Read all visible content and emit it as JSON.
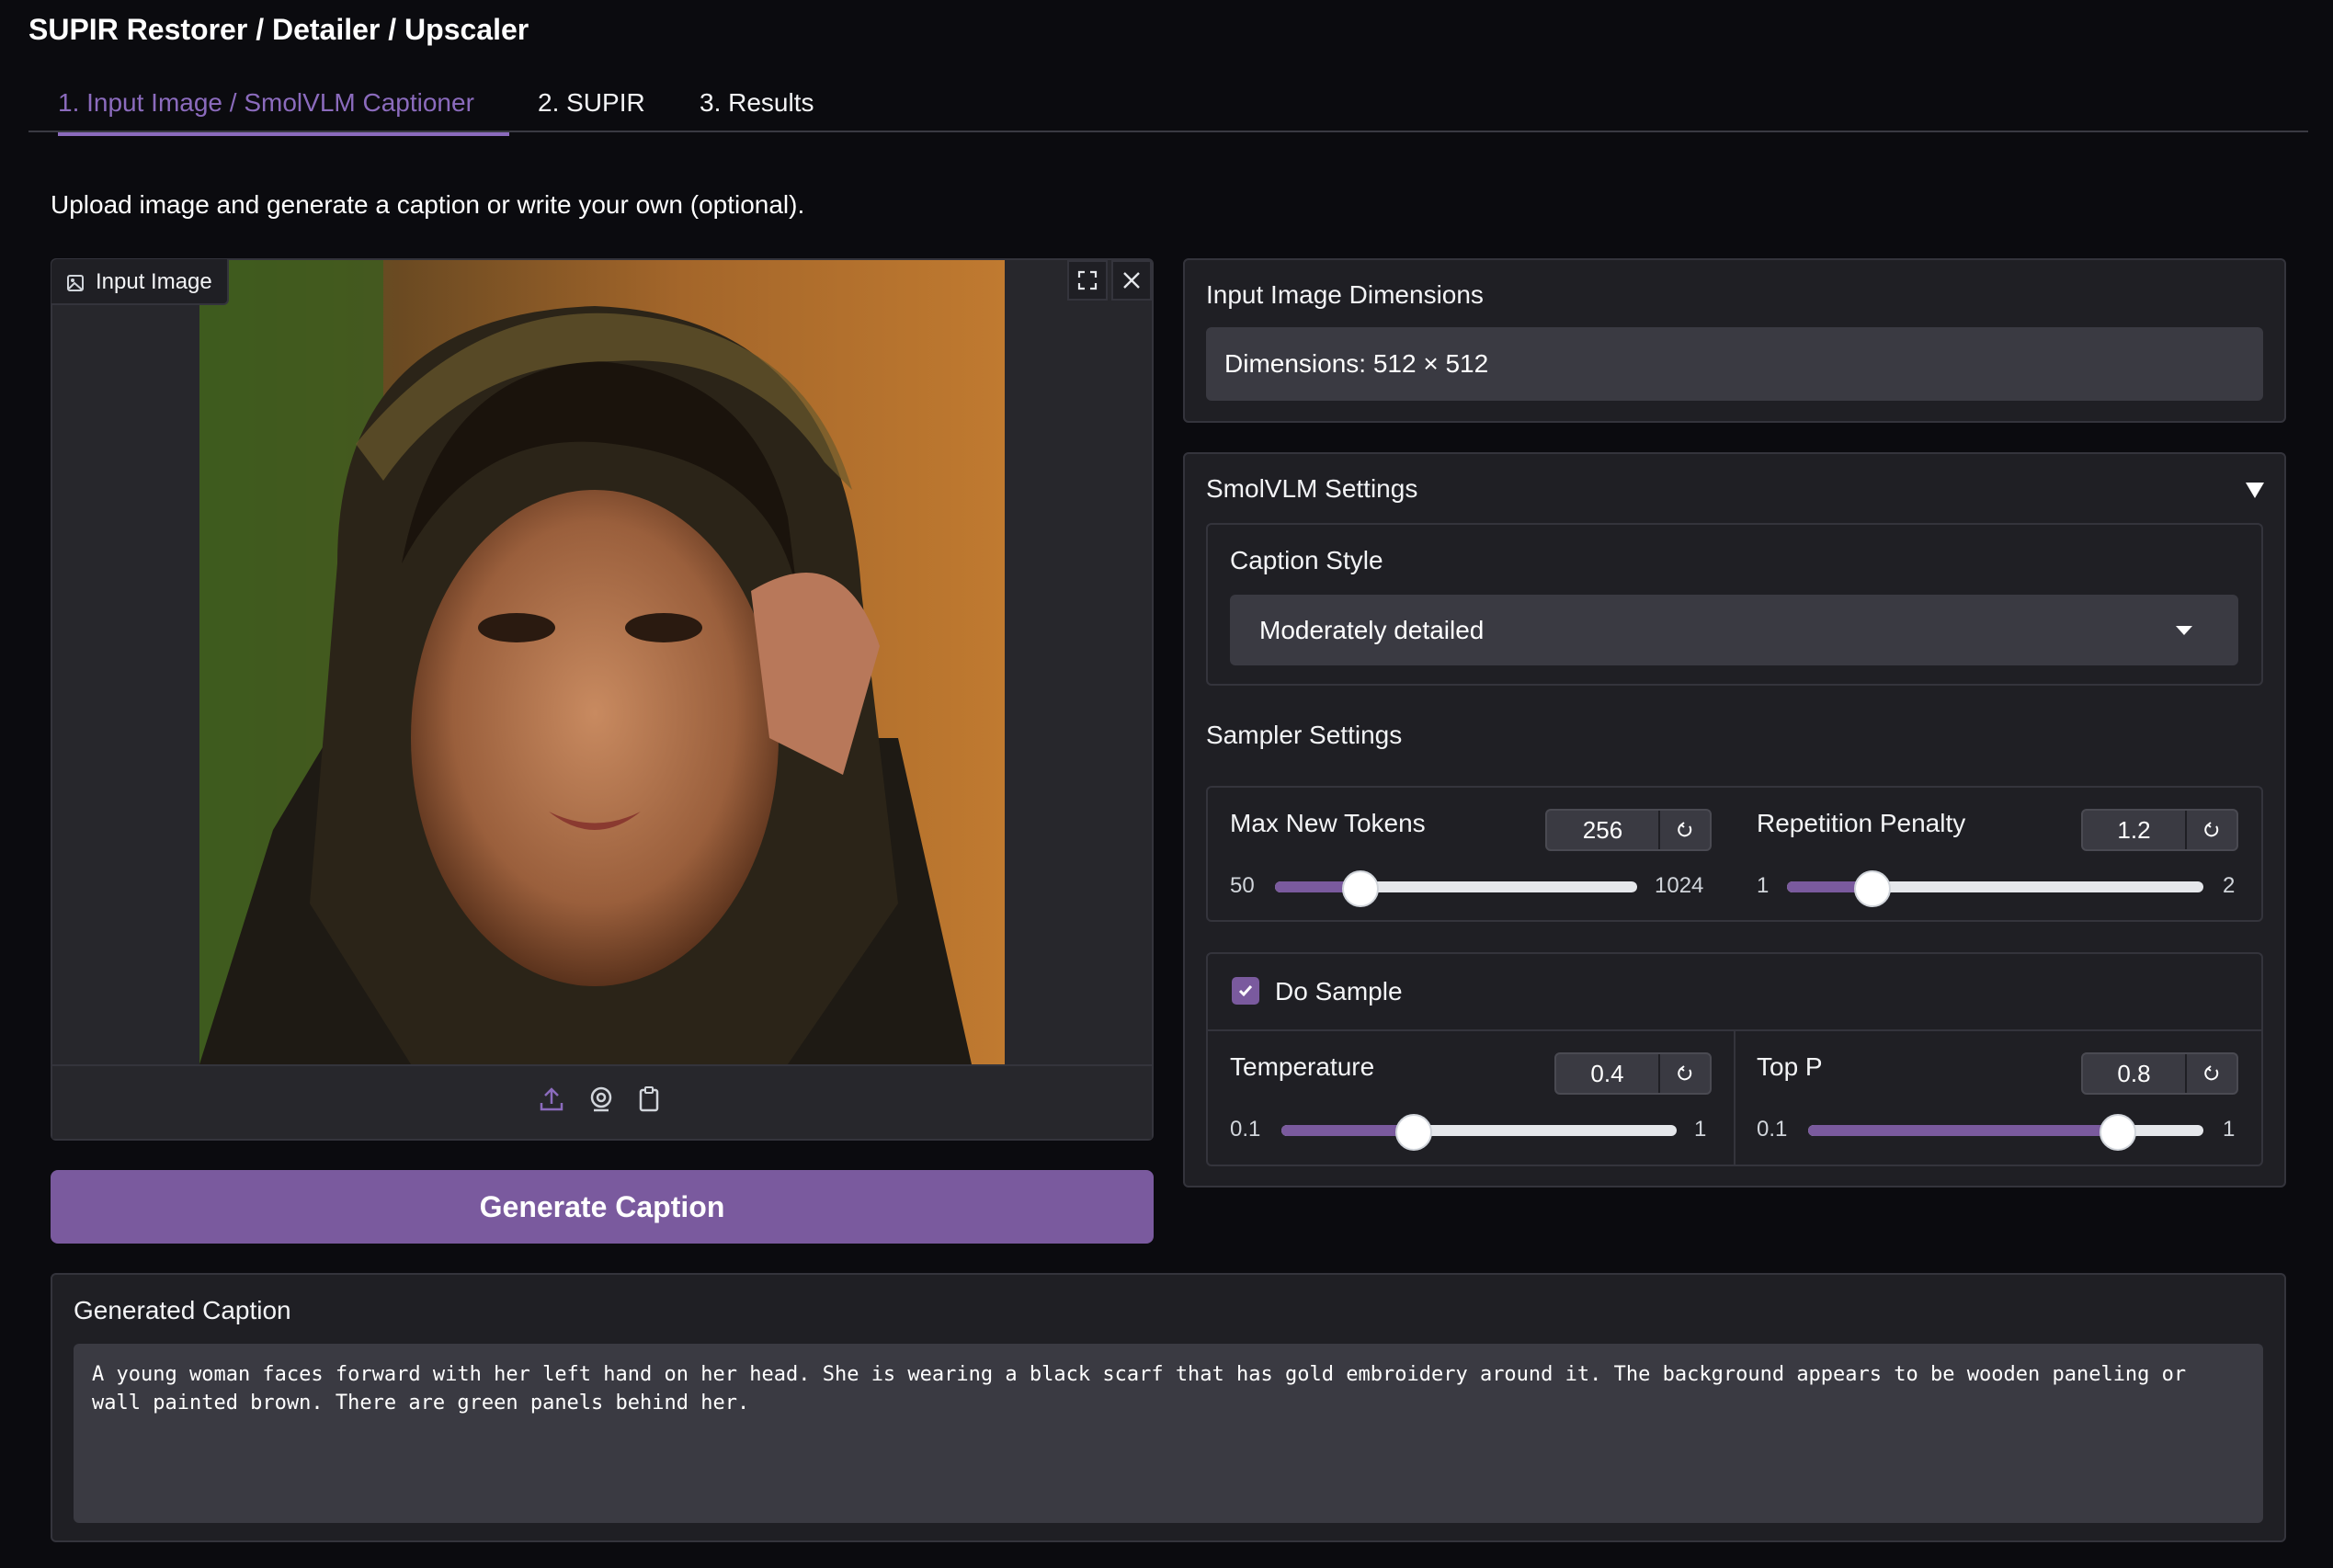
{
  "app": {
    "title": "SUPIR Restorer / Detailer / Upscaler"
  },
  "tabs": [
    {
      "label": "1. Input Image / SmolVLM Captioner",
      "active": true
    },
    {
      "label": "2. SUPIR",
      "active": false
    },
    {
      "label": "3. Results",
      "active": false
    }
  ],
  "intro": "Upload image and generate a caption or write your own (optional).",
  "image_panel": {
    "label": "Input Image",
    "icons": [
      "image-icon",
      "fullscreen-icon",
      "close-icon",
      "upload-icon",
      "webcam-icon",
      "clipboard-icon"
    ]
  },
  "generate_button": "Generate Caption",
  "dimensions": {
    "label": "Input Image Dimensions",
    "value": "Dimensions: 512 × 512"
  },
  "smolvlm": {
    "title": "SmolVLM Settings",
    "toggle_icon": "triangle-down-icon",
    "caption_style": {
      "label": "Caption Style",
      "selected": "Moderately detailed"
    },
    "sampler_title": "Sampler Settings",
    "max_new_tokens": {
      "label": "Max New Tokens",
      "value": "256",
      "min": "50",
      "max": "1024",
      "fraction": 0.23
    },
    "repetition_penalty": {
      "label": "Repetition Penalty",
      "value": "1.2",
      "min": "1",
      "max": "2",
      "fraction": 0.2
    },
    "do_sample": {
      "label": "Do Sample",
      "checked": true
    },
    "temperature": {
      "label": "Temperature",
      "value": "0.4",
      "min": "0.1",
      "max": "1",
      "fraction": 0.33
    },
    "top_p": {
      "label": "Top P",
      "value": "0.8",
      "min": "0.1",
      "max": "1",
      "fraction": 0.78
    }
  },
  "generated_caption": {
    "label": "Generated Caption",
    "text": "A young woman faces forward with her left hand on her head. She is wearing a black scarf that has gold embroidery around it. The background appears to be wooden paneling or wall painted brown. There are green panels behind her."
  },
  "colors": {
    "accent": "#7a5a9e",
    "tab_active": "#8b6bbd",
    "background": "#0b0b0f",
    "panel": "#1f1f24",
    "input": "#3a3a42"
  }
}
